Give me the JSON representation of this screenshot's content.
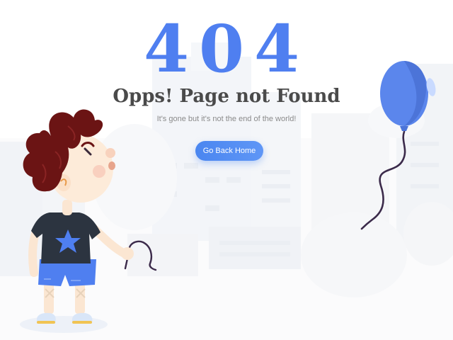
{
  "error": {
    "code": "404",
    "title": "Opps! Page not Found",
    "message": "It's gone but it's not the end of the world!"
  },
  "actions": {
    "home_label": "Go Back Home"
  },
  "colors": {
    "accent": "#4f7ff0",
    "button": "#4a86f0",
    "title_text": "#4a4a4a",
    "message_text": "#8a8a8a",
    "balloon": "#5b86ec",
    "hair": "#6b1414",
    "shirt": "#2c3440",
    "shorts": "#4f7ff0"
  },
  "illustration": {
    "character": "boy-holding-string-icon",
    "balloon": "balloon-icon",
    "background": "city-skyline-icon"
  }
}
